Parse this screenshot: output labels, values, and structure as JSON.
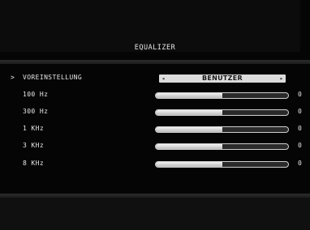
{
  "screen": {
    "title": "EQUALIZER"
  },
  "menu": {
    "cursor": ">",
    "preset": {
      "label": "VOREINSTELLUNG",
      "value": "BENUTZER",
      "left_arrow": "◂",
      "right_arrow": "▸"
    },
    "bands": [
      {
        "label": "100 Hz",
        "value": "0",
        "level": 0.5
      },
      {
        "label": "300 Hz",
        "value": "0",
        "level": 0.5
      },
      {
        "label": "1 KHz",
        "value": "0",
        "level": 0.5
      },
      {
        "label": "3 KHz",
        "value": "0",
        "level": 0.5
      },
      {
        "label": "8 KHz",
        "value": "0",
        "level": 0.5
      }
    ]
  }
}
